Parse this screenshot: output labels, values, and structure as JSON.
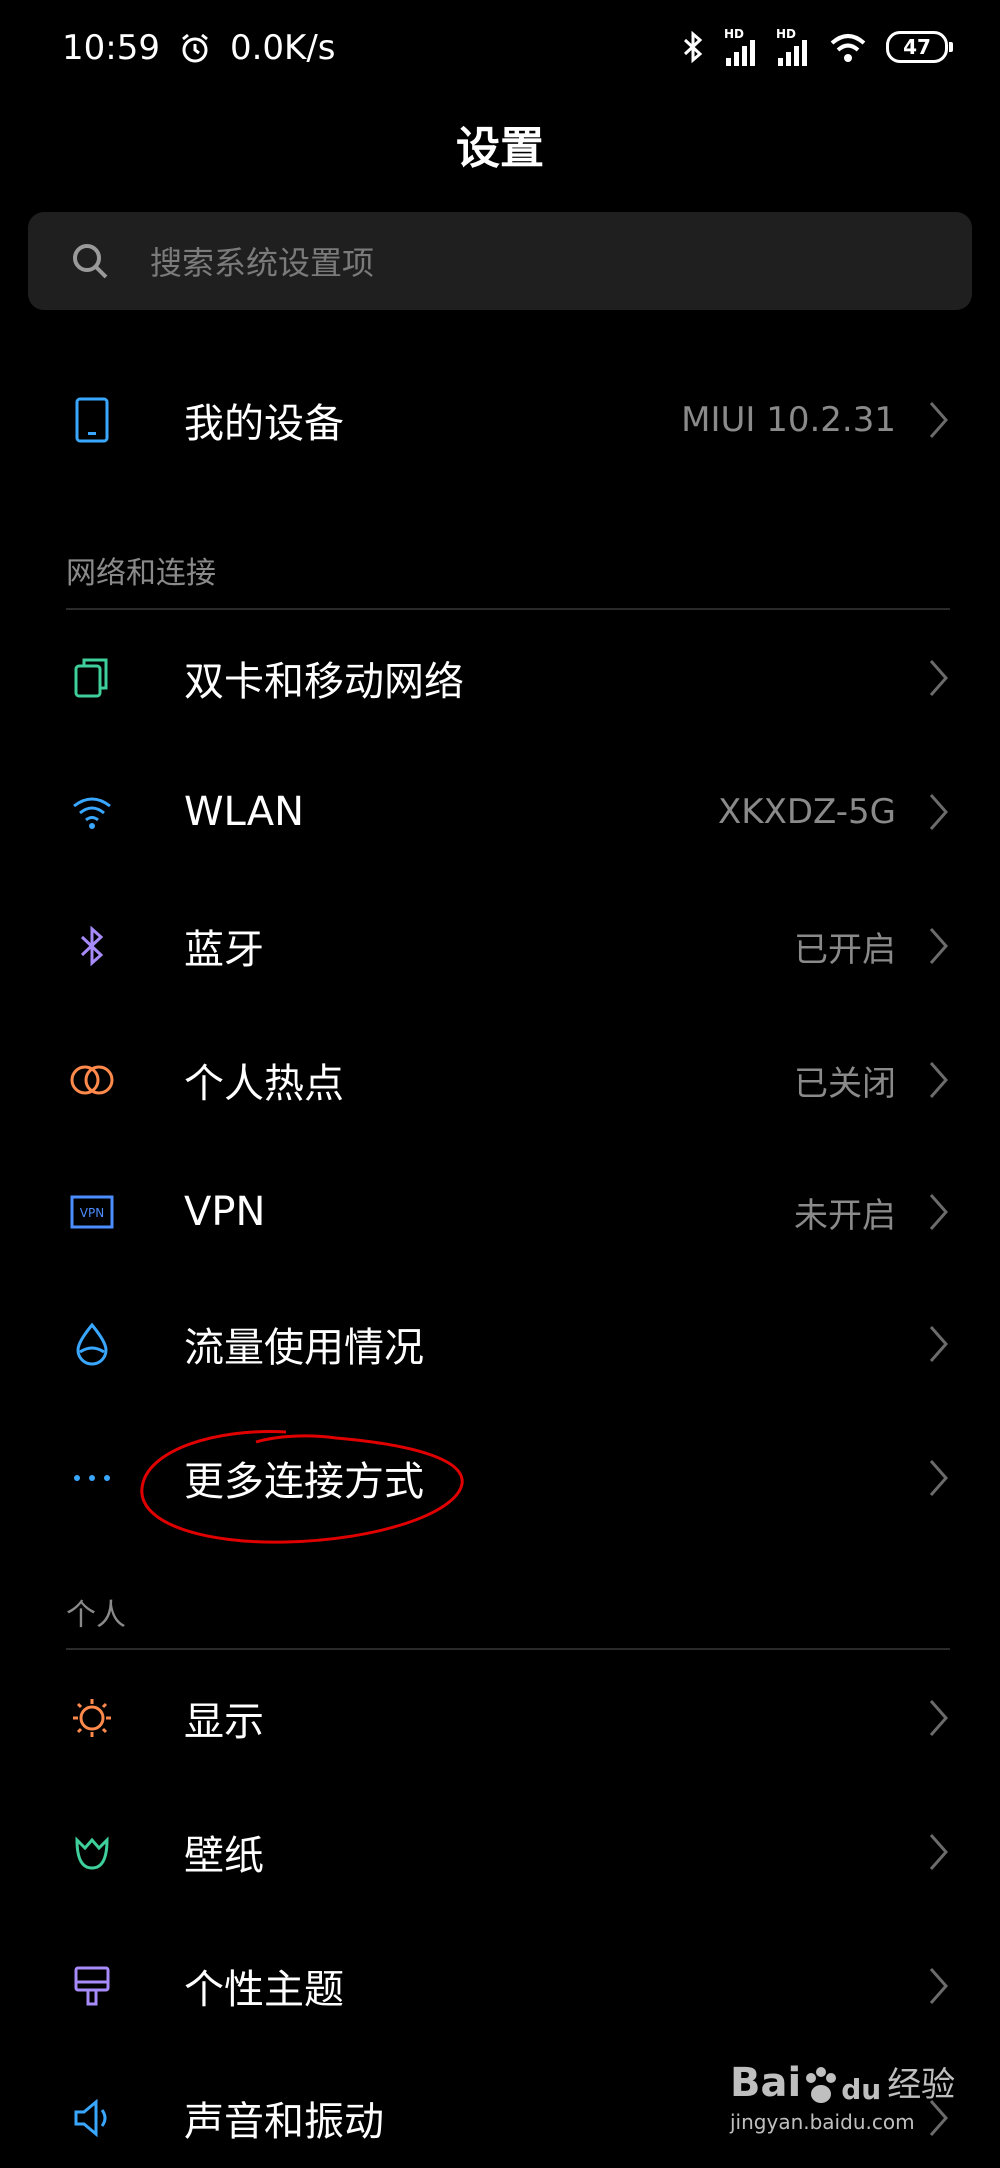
{
  "status": {
    "time": "10:59",
    "speed": "0.0K/s",
    "battery": "47",
    "hd1": "HD",
    "hd2": "HD"
  },
  "title": "设置",
  "search": {
    "placeholder": "搜索系统设置项"
  },
  "device": {
    "label": "我的设备",
    "value": "MIUI 10.2.31"
  },
  "sections": {
    "network": "网络和连接",
    "personal": "个人"
  },
  "network_items": [
    {
      "label": "双卡和移动网络",
      "value": "",
      "icon": "sim-card-icon",
      "color": "#3ecf9a"
    },
    {
      "label": "WLAN",
      "value": "XKXDZ-5G",
      "icon": "wifi-icon",
      "color": "#3aa7ff"
    },
    {
      "label": "蓝牙",
      "value": "已开启",
      "icon": "bluetooth-icon",
      "color": "#a78bfa"
    },
    {
      "label": "个人热点",
      "value": "已关闭",
      "icon": "hotspot-icon",
      "color": "#ff8a4c"
    },
    {
      "label": "VPN",
      "value": "未开启",
      "icon": "vpn-icon",
      "color": "#4c8dff"
    },
    {
      "label": "流量使用情况",
      "value": "",
      "icon": "data-usage-icon",
      "color": "#3aa7ff"
    },
    {
      "label": "更多连接方式",
      "value": "",
      "icon": "more-icon",
      "color": "#3aa7ff"
    }
  ],
  "personal_items": [
    {
      "label": "显示",
      "icon": "brightness-icon",
      "color": "#ff8a4c"
    },
    {
      "label": "壁纸",
      "icon": "wallpaper-icon",
      "color": "#3ecf9a"
    },
    {
      "label": "个性主题",
      "icon": "theme-icon",
      "color": "#a78bfa"
    },
    {
      "label": "声音和振动",
      "icon": "sound-icon",
      "color": "#3aa7ff"
    }
  ],
  "watermark": {
    "brand": "Bai",
    "brand2": "du",
    "suffix": "经验",
    "url": "jingyan.baidu.com"
  }
}
